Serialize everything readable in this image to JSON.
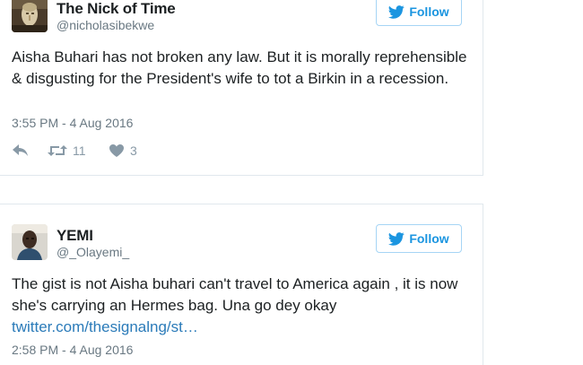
{
  "tweets": [
    {
      "user_name": "The Nick of Time",
      "user_handle": "@nicholasibekwe",
      "follow_label": "Follow",
      "text": "Aisha Buhari has not broken any law. But it is morally reprehensible & disgusting for the President's wife to tot a Birkin in a recession.",
      "timestamp": "3:55 PM - 4 Aug 2016",
      "retweet_count": "11",
      "like_count": "3"
    },
    {
      "user_name": "YEMI",
      "user_handle": "@_Olayemi_",
      "follow_label": "Follow",
      "text": "The gist is not Aisha buhari can't travel to America again , it is now she's carrying an Hermes bag. Una go dey okay",
      "link": "twitter.com/thesignalng/st…",
      "timestamp": "2:58 PM - 4 Aug 2016"
    }
  ],
  "colors": {
    "twitter_blue": "#1b95e0",
    "link_blue": "#2b7bb9",
    "meta_gray": "#697882",
    "icon_gray": "#8899a6"
  }
}
